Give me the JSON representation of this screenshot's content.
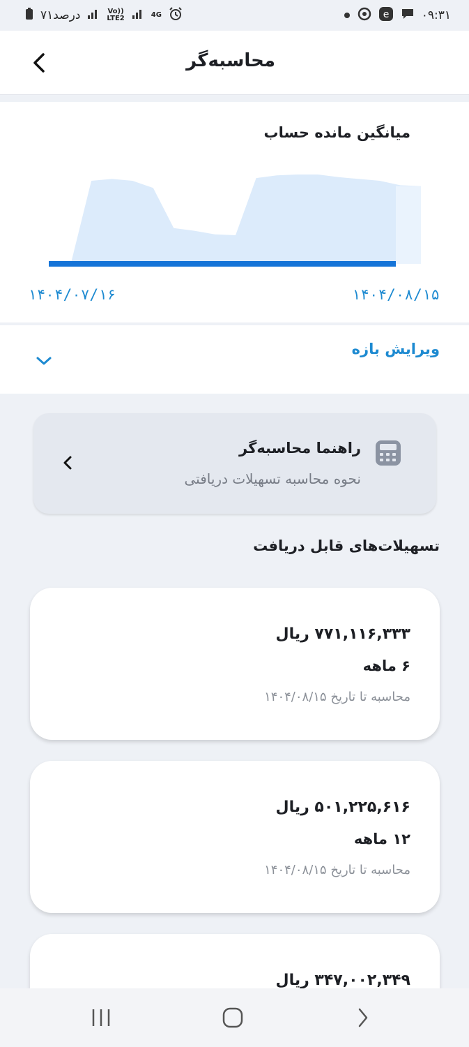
{
  "status_bar": {
    "time": "۰۹:۳۱",
    "battery": "۷۱درصد",
    "network_4g": "4G",
    "volte_top": "Vo))",
    "volte_bottom": "LTE2"
  },
  "header": {
    "title": "محاسبه‌گر"
  },
  "chart": {
    "title": "میانگین مانده حساب",
    "start_date": "۱۴۰۴/۰۷/۱۶",
    "end_date": "۱۴۰۴/۰۸/۱۵"
  },
  "chart_data": {
    "type": "area",
    "title": "میانگین مانده حساب",
    "x_range_labels": [
      "۱۴۰۴/۰۷/۱۶",
      "۱۴۰۴/۰۸/۱۵"
    ],
    "values": [
      0,
      0,
      0.93,
      0.95,
      0.93,
      0.85,
      0.4,
      0.37,
      0.33,
      0.32,
      0.96,
      0.99,
      1.0,
      1.0,
      0.97,
      0.95,
      0.93,
      0.88,
      0.87
    ],
    "grid": false,
    "legend": false
  },
  "range": {
    "label": "ویرایش بازه"
  },
  "guide": {
    "title": "راهنما محاسبه‌گر",
    "subtitle": "نحوه محاسبه تسهیلات دریافتی"
  },
  "section": {
    "title": "تسهیلات‌های قابل دریافت"
  },
  "offers": [
    {
      "amount": "۷۷۱,۱۱۶,۳۳۳ ریال",
      "term": "۶ ماهه",
      "date": "محاسبه تا تاریخ ۱۴۰۴/۰۸/۱۵"
    },
    {
      "amount": "۵۰۱,۲۲۵,۶۱۶ ریال",
      "term": "۱۲ ماهه",
      "date": "محاسبه تا تاریخ ۱۴۰۴/۰۸/۱۵"
    },
    {
      "amount": "۳۴۷,۰۰۲,۳۴۹ ریال",
      "term": "",
      "date": ""
    }
  ],
  "colors": {
    "accent": "#1d8ad1",
    "chart_fill": "#dcebfb",
    "chart_baseline": "#1574d8",
    "background": "#eef1f6"
  }
}
